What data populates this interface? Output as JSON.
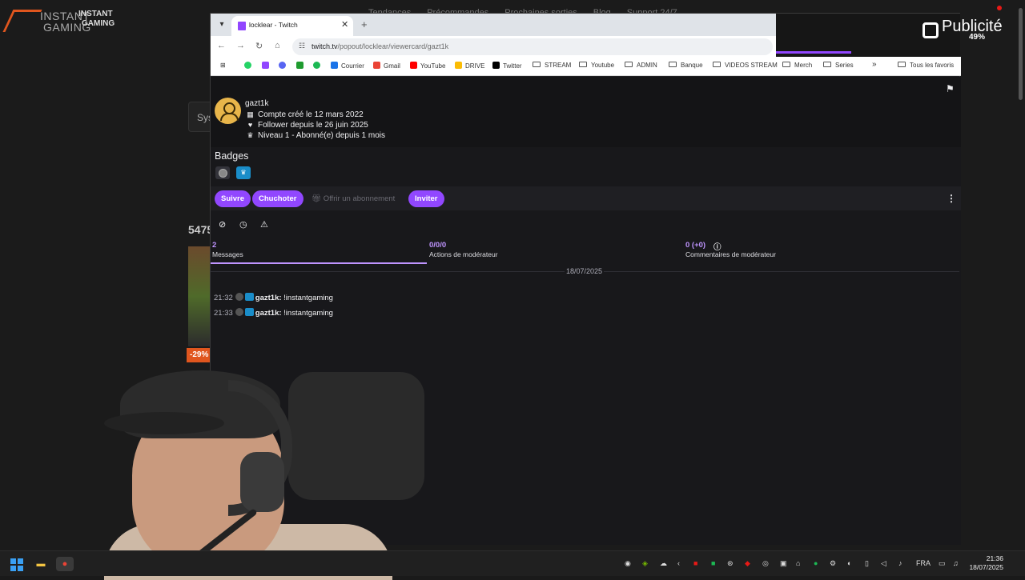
{
  "background_site": {
    "logo_line1": "INSTANT",
    "logo_line2": "GAMING",
    "logo_small1": "INSTANT",
    "logo_small2": "GAMING",
    "nav": [
      "Tendances",
      "Précommandes",
      "Prochaines sorties",
      "Blog",
      "Support 24/7"
    ],
    "sys_text": "Sys",
    "count_text": "5475",
    "discount": "-29%"
  },
  "browser": {
    "tab_title": "locklear - Twitch",
    "url_host": "twitch.tv",
    "url_path": "/popout/locklear/viewercard/gazt1k",
    "bookmarks": [
      {
        "label": "",
        "icon": "whatsapp-icon",
        "color": "#25d366"
      },
      {
        "label": "",
        "icon": "twitch-icon",
        "color": "#9146ff"
      },
      {
        "label": "",
        "icon": "discord-icon",
        "color": "#5865f2"
      },
      {
        "label": "",
        "icon": "tweetdeck-icon",
        "color": "#1f9b2f"
      },
      {
        "label": "",
        "icon": "spotify-icon",
        "color": "#1db954"
      },
      {
        "label": "Courrier",
        "icon": "mail-icon",
        "color": "#1a73e8"
      },
      {
        "label": "Gmail",
        "icon": "gmail-icon",
        "color": "#ea4335"
      },
      {
        "label": "YouTube",
        "icon": "youtube-icon",
        "color": "#ff0000"
      },
      {
        "label": "DRIVE",
        "icon": "drive-icon",
        "color": "#fbbc04"
      },
      {
        "label": "Twitter",
        "icon": "x-icon",
        "color": "#000000"
      },
      {
        "label": "STREAM",
        "icon": "folder-icon",
        "color": ""
      },
      {
        "label": "Youtube",
        "icon": "folder-icon",
        "color": ""
      },
      {
        "label": "ADMIN",
        "icon": "folder-icon",
        "color": ""
      },
      {
        "label": "Banque",
        "icon": "folder-icon",
        "color": ""
      },
      {
        "label": "VIDEOS STREAM",
        "icon": "folder-icon",
        "color": ""
      },
      {
        "label": "Merch",
        "icon": "folder-icon",
        "color": ""
      },
      {
        "label": "Series",
        "icon": "folder-icon",
        "color": ""
      }
    ],
    "more_bookmarks": "»",
    "all_favorites": "Tous les favoris"
  },
  "viewer_card": {
    "username": "gazt1k",
    "account_created": "Compte créé le 12 mars 2022",
    "follower_since": "Follower depuis le 26 juin 2025",
    "sub_level": "Niveau 1 - Abonné(e) depuis 1 mois",
    "badges_title": "Badges",
    "buttons": {
      "follow": "Suivre",
      "whisper": "Chuchoter",
      "gift_sub": "Offrir un abonnement",
      "invite": "Inviter"
    },
    "stats": [
      {
        "value": "2",
        "label": "Messages"
      },
      {
        "value": "0/0/0",
        "label": "Actions de modérateur"
      },
      {
        "value": "0 (+0)",
        "label": "Commentaires de modérateur"
      }
    ],
    "date_separator": "18/07/2025",
    "messages": [
      {
        "time": "21:32",
        "user": "gazt1k:",
        "text": "!instantgaming"
      },
      {
        "time": "21:33",
        "user": "gazt1k:",
        "text": "!instantgaming"
      }
    ],
    "accent_color": "#9147ff"
  },
  "ad_overlay": {
    "label": "Publicité",
    "percent": "49%"
  },
  "taskbar": {
    "language": "FRA",
    "time": "21:36",
    "date": "18/07/2025"
  }
}
